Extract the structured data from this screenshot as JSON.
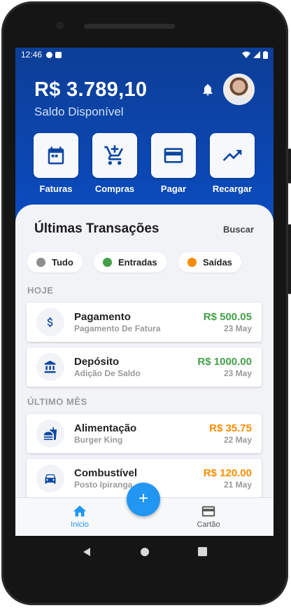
{
  "status_bar": {
    "time": "12:46"
  },
  "header": {
    "balance": "R$ 3.789,10",
    "balance_label": "Saldo Disponível",
    "notification_icon": "bell-icon",
    "avatar_icon": "user-avatar"
  },
  "actions": [
    {
      "label": "Faturas",
      "icon": "calendar-icon"
    },
    {
      "label": "Compras",
      "icon": "cart-plus-icon"
    },
    {
      "label": "Pagar",
      "icon": "credit-card-icon"
    },
    {
      "label": "Recargar",
      "icon": "trending-up-icon"
    }
  ],
  "transactions_card": {
    "title": "Últimas Transações",
    "search_label": "Buscar",
    "filters": [
      {
        "label": "Tudo",
        "color": "#8e8e8e"
      },
      {
        "label": "Entradas",
        "color": "#43a047"
      },
      {
        "label": "Saídas",
        "color": "#fb8c00"
      }
    ],
    "sections": [
      {
        "heading": "HOJE",
        "items": [
          {
            "name": "Pagamento",
            "description": "Pagamento De Fatura",
            "amount": "R$ 500.05",
            "date": "23 May",
            "icon": "dollar-icon",
            "color": "#43a047"
          },
          {
            "name": "Depósito",
            "description": "Adição De Saldo",
            "amount": "R$ 1000.00",
            "date": "23 May",
            "icon": "bank-icon",
            "color": "#43a047"
          }
        ]
      },
      {
        "heading": "ÚLTIMO MÊS",
        "items": [
          {
            "name": "Alimentação",
            "description": "Burger King",
            "amount": "R$ 35.75",
            "date": "22 May",
            "icon": "fastfood-icon",
            "color": "#fb8c00"
          },
          {
            "name": "Combustível",
            "description": "Posto Ipiranga",
            "amount": "R$ 120.00",
            "date": "21 May",
            "icon": "car-icon",
            "color": "#fb8c00"
          }
        ]
      }
    ]
  },
  "bottom_nav": {
    "home_label": "Inicio",
    "card_label": "Cartão",
    "fab_label": "+",
    "active_color": "#2196f3"
  }
}
